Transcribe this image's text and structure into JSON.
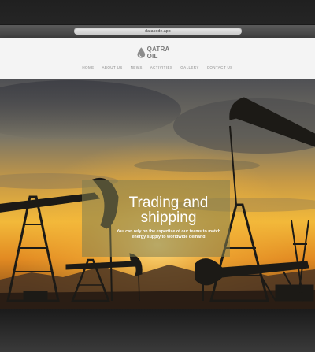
{
  "browser": {
    "url": "datacode.app"
  },
  "site": {
    "logo_text": "QATRA OIL",
    "nav": [
      "HOME",
      "ABOUT US",
      "NEWS",
      "ACTIVITIES",
      "GALLERY",
      "CONTACT US"
    ],
    "hero": {
      "title_line1": "Trading and",
      "title_line2": "shipping",
      "subtitle_line1": "You can rely on the expertise of our teams to match",
      "subtitle_line2": "energy supply to worldwide demand"
    }
  },
  "colors": {
    "header_bg": "#f4f4f4",
    "nav_text": "#8a8a8a",
    "hero_sky_top": "#5c5a56",
    "hero_sky_glow": "#f2b93a",
    "silhouette": "#1c1a16"
  }
}
